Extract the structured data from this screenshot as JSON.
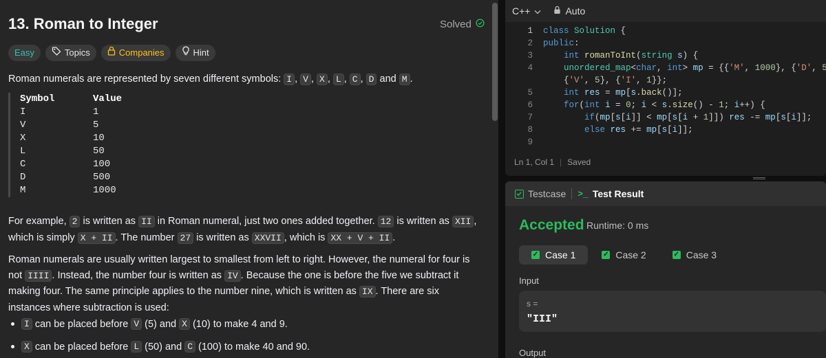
{
  "problem": {
    "title": "13. Roman to Integer",
    "solved_label": "Solved",
    "tags": {
      "difficulty": "Easy",
      "topics": "Topics",
      "companies": "Companies",
      "hint": "Hint"
    },
    "intro": {
      "text": "Roman numerals are represented by seven different symbols: ",
      "symbols": [
        "I",
        "V",
        "X",
        "L",
        "C",
        "D",
        "M"
      ],
      "and": "and",
      "end": "."
    },
    "table": {
      "headers": [
        "Symbol",
        "Value"
      ],
      "rows": [
        [
          "I",
          "1"
        ],
        [
          "V",
          "5"
        ],
        [
          "X",
          "10"
        ],
        [
          "L",
          "50"
        ],
        [
          "C",
          "100"
        ],
        [
          "D",
          "500"
        ],
        [
          "M",
          "1000"
        ]
      ]
    },
    "example": {
      "p1": "For example, ",
      "c1": "2",
      "p2": " is written as ",
      "c2": "II",
      "p3": " in Roman numeral, just two ones added together. ",
      "c3": "12",
      "p4": " is written as ",
      "c4": "XII",
      "p5": ", which is simply ",
      "c5": "X + II",
      "p6": ". The number ",
      "c6": "27",
      "p7": " is written as ",
      "c7": "XXVII",
      "p8": ", which is ",
      "c8": "XX + V + II",
      "p9": "."
    },
    "order": {
      "p1": "Roman numerals are usually written largest to smallest from left to right. However, the numeral for four is not ",
      "c1": "IIII",
      "p2": ". Instead, the number four is written as ",
      "c2": "IV",
      "p3": ". Because the one is before the five we subtract it making four. The same principle applies to the number nine, which is written as ",
      "c3": "IX",
      "p4": ". There are six instances where subtraction is used:"
    },
    "bullets": [
      {
        "c1": "I",
        "t1": " can be placed before ",
        "c2": "V",
        "t2": " (5) and ",
        "c3": "X",
        "t3": " (10) to make 4 and 9."
      },
      {
        "c1": "X",
        "t1": " can be placed before ",
        "c2": "L",
        "t2": " (50) and ",
        "c3": "C",
        "t3": " (100) to make 40 and 90."
      }
    ]
  },
  "editor": {
    "language": "C++",
    "mode": "Auto",
    "line_numbers": [
      "1",
      "2",
      "3",
      "4",
      "",
      "5",
      "6",
      "7",
      "8",
      "9"
    ],
    "status": {
      "position": "Ln 1, Col 1",
      "saved": "Saved"
    }
  },
  "result": {
    "tabs": {
      "testcase": "Testcase",
      "test_result": "Test Result"
    },
    "verdict": "Accepted",
    "runtime": "Runtime: 0 ms",
    "cases": [
      "Case 1",
      "Case 2",
      "Case 3"
    ],
    "input_label": "Input",
    "input_var": "s =",
    "input_value": "\"III\"",
    "output_label": "Output"
  },
  "colors": {
    "accent_green": "#2cbb5d",
    "easy": "#33c2b2",
    "companies": "#ffc01e"
  }
}
